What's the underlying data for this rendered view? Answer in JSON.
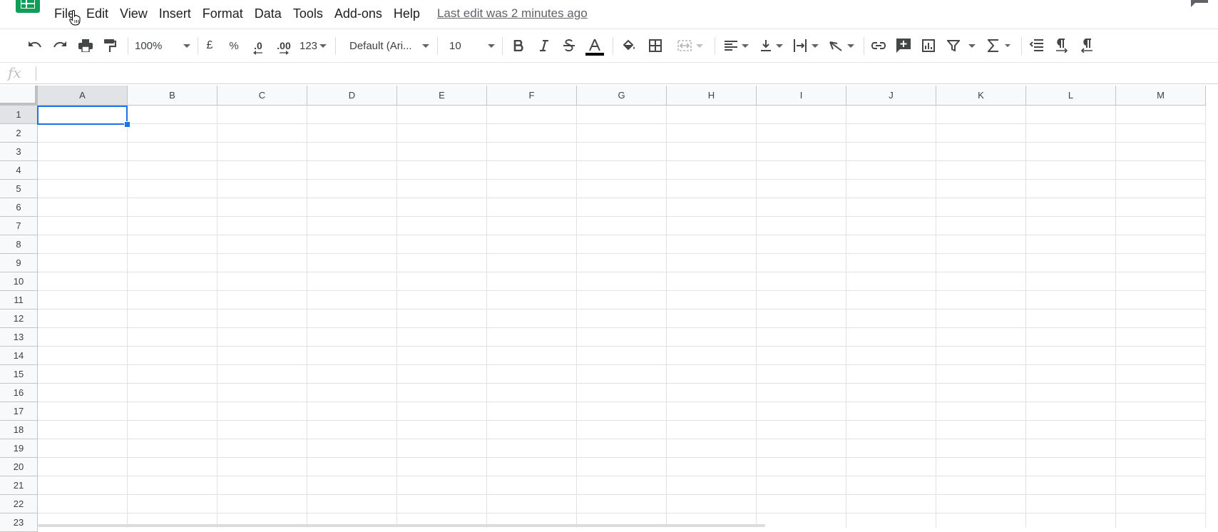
{
  "menu": {
    "items": [
      "File",
      "Edit",
      "View",
      "Insert",
      "Format",
      "Data",
      "Tools",
      "Add-ons",
      "Help"
    ],
    "last_edit": "Last edit was 2 minutes ago"
  },
  "toolbar": {
    "zoom": "100%",
    "currency": "£",
    "percent": "%",
    "decrease_decimal": ".0",
    "increase_decimal": ".00",
    "more_formats": "123",
    "font": "Default (Ari...",
    "font_size": "10",
    "text_color": "#000000"
  },
  "formula_bar": {
    "label": "fx",
    "value": ""
  },
  "grid": {
    "columns": [
      "A",
      "B",
      "C",
      "D",
      "E",
      "F",
      "G",
      "H",
      "I",
      "J",
      "K",
      "L",
      "M"
    ],
    "rows": [
      "1",
      "2",
      "3",
      "4",
      "5",
      "6",
      "7",
      "8",
      "9",
      "10",
      "11",
      "12",
      "13",
      "14",
      "15",
      "16",
      "17",
      "18",
      "19",
      "20",
      "21",
      "22",
      "23"
    ],
    "selected_cell": "A1"
  },
  "colors": {
    "brand": "#0f9d58",
    "selection": "#1a73e8"
  }
}
